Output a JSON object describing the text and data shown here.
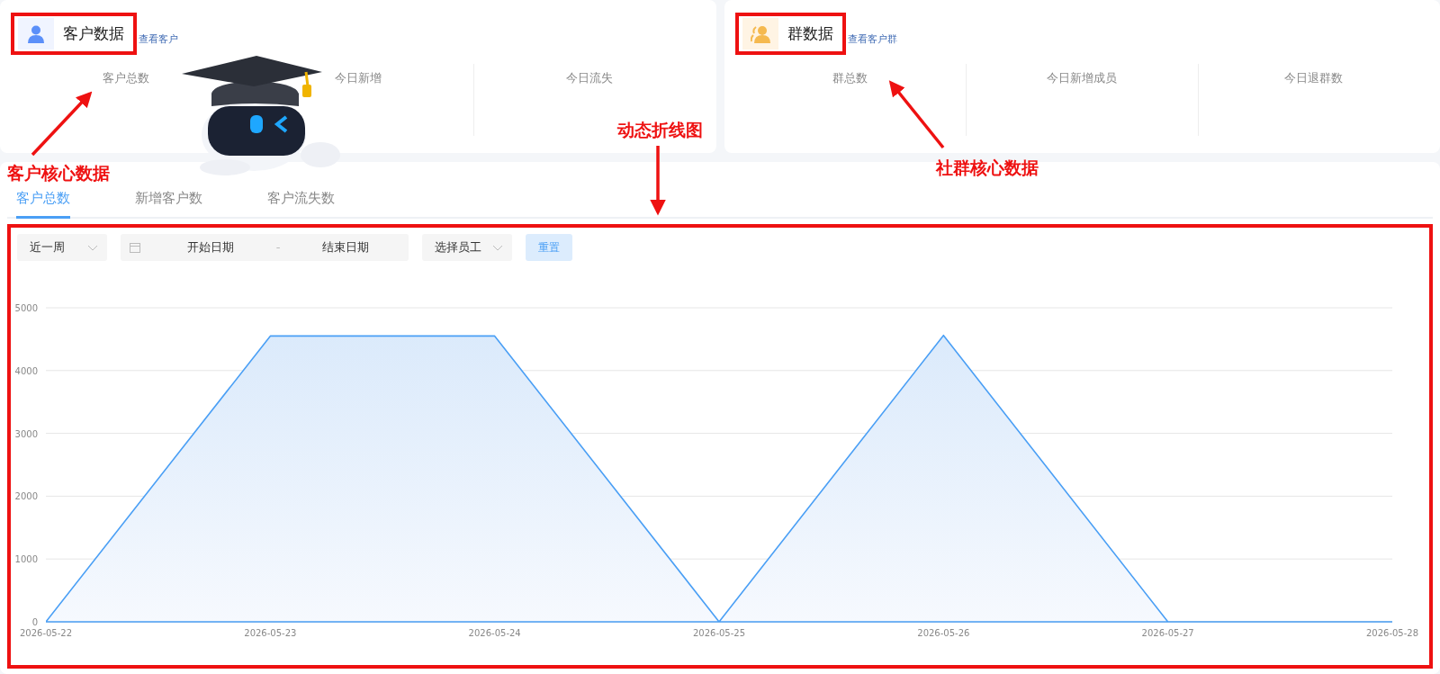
{
  "customer_card": {
    "title": "客户数据",
    "link": "查看客户",
    "metrics": [
      {
        "label": "客户总数"
      },
      {
        "label": "今日新增"
      },
      {
        "label": "今日流失"
      }
    ]
  },
  "group_card": {
    "title": "群数据",
    "link": "查看客户群",
    "metrics": [
      {
        "label": "群总数"
      },
      {
        "label": "今日新增成员"
      },
      {
        "label": "今日退群数"
      }
    ]
  },
  "tabs": [
    {
      "label": "客户总数",
      "selected": true
    },
    {
      "label": "新增客户数",
      "selected": false
    },
    {
      "label": "客户流失数",
      "selected": false
    }
  ],
  "filters": {
    "period": "近一周",
    "start_placeholder": "开始日期",
    "separator": "-",
    "end_placeholder": "结束日期",
    "staff_placeholder": "选择员工",
    "reset": "重置"
  },
  "chart": {
    "chart_data": {
      "type": "area",
      "categories": [
        "2026-05-22",
        "2026-05-23",
        "2026-05-24",
        "2026-05-25",
        "2026-05-26",
        "2026-05-27",
        "2026-05-28"
      ],
      "series": [
        {
          "color": "#4a9ff5",
          "values": [
            0,
            4550,
            4550,
            0,
            4560,
            0,
            0
          ]
        }
      ],
      "grid": true,
      "ylim": [
        0,
        5000
      ],
      "yticks": [
        0,
        1000,
        2000,
        3000,
        4000,
        5000
      ]
    }
  },
  "callouts": [
    {
      "text": "客户核心数据"
    },
    {
      "text": "动态折线图"
    },
    {
      "text": "社群核心数据"
    }
  ]
}
